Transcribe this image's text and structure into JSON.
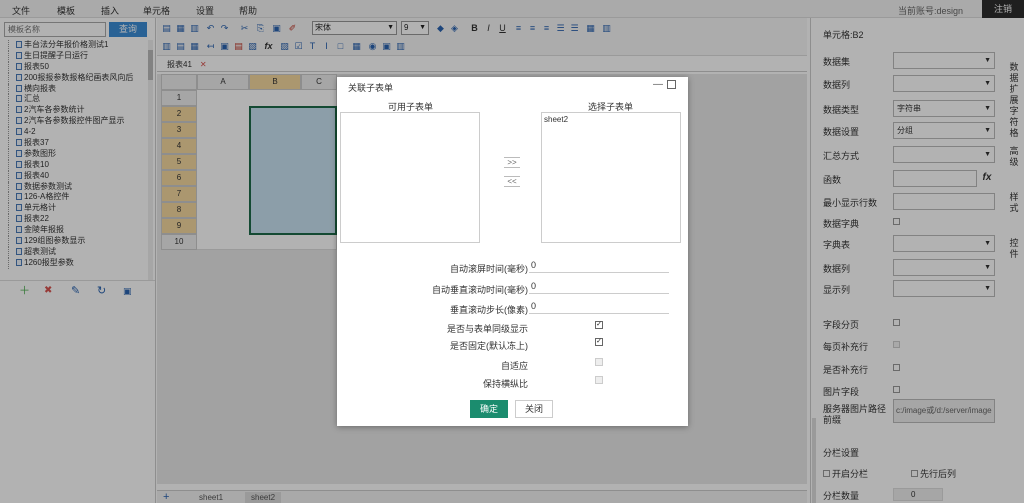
{
  "menubar": {
    "items": [
      "文件",
      "模板",
      "插入",
      "单元格",
      "设置",
      "帮助"
    ],
    "user_label": "当前账号:design",
    "logout_label": "注销"
  },
  "left_panel": {
    "search_placeholder": "模板名称",
    "search_button": "查询",
    "tree_items": [
      "丰台法分年报价格测试1",
      "生日提醒子日运行",
      "报表50",
      "200报报参数报格纪画表风向后",
      "横向报表",
      "汇总",
      "2汽车各参数统计",
      "2汽车各参数报控件图产显示",
      "4-2",
      "报表37",
      "参数图形",
      "报表10",
      "报表40",
      "数据参数测试",
      "126-A格控件",
      "单元格计",
      "报表22",
      "金陵年报报",
      "129组图参数显示",
      "超表测试",
      "1260报型参数"
    ]
  },
  "toolbar": {
    "font_value": "宋体",
    "size_value": "9"
  },
  "sheet_tabs_top": {
    "active": "报表41"
  },
  "grid": {
    "columns": [
      "A",
      "B",
      "C"
    ],
    "rows": [
      "1",
      "2",
      "3",
      "4",
      "5",
      "6",
      "7",
      "8",
      "9",
      "10"
    ]
  },
  "sheet_tabs_bottom": [
    "sheet1",
    "sheet2"
  ],
  "right_panel": {
    "title": "单元格:B2",
    "props": [
      {
        "label": "数据集",
        "value": "",
        "type": "select"
      },
      {
        "label": "数据列",
        "value": "",
        "type": "select"
      },
      {
        "label": "数据类型",
        "value": "字符串",
        "type": "select"
      },
      {
        "label": "数据设置",
        "value": "分组",
        "type": "select"
      },
      {
        "label": "汇总方式",
        "value": "",
        "type": "select"
      },
      {
        "label": "函数",
        "value": "",
        "type": "text"
      },
      {
        "label": "最小显示行数",
        "value": "",
        "type": "text"
      },
      {
        "label": "数据字典",
        "value": "",
        "type": "check"
      },
      {
        "label": "字典表",
        "value": "",
        "type": "select"
      },
      {
        "label": "数据列",
        "value": "",
        "type": "select"
      },
      {
        "label": "显示列",
        "value": "",
        "type": "select"
      }
    ],
    "checks": [
      {
        "label": "字段分页"
      },
      {
        "label": "每页补充行"
      },
      {
        "label": "是否补充行"
      },
      {
        "label": "图片字段"
      }
    ],
    "image_path_label": "服务器图片路径前缀",
    "image_path_value": "c:/image或/d:/server/image",
    "section_label": "分栏设置",
    "col_open_label": "开启分栏",
    "col_first_label": "先行后列",
    "col_count_label": "分栏数量",
    "col_count_value": "0"
  },
  "side_tabs": [
    "数据扩展字符格",
    "高级",
    "样式",
    "控件"
  ],
  "dialog": {
    "title": "关联子表单",
    "available_label": "可用子表单",
    "selected_label": "选择子表单",
    "selected_items": [
      "sheet2"
    ],
    "move_right": ">>",
    "move_left": "<<",
    "fields": [
      {
        "label": "自动滚屏时间(毫秒)",
        "value": "0"
      },
      {
        "label": "自动垂直滚动时间(毫秒)",
        "value": "0"
      },
      {
        "label": "垂直滚动步长(像素)",
        "value": "0"
      }
    ],
    "checks": [
      {
        "label": "是否与表单同级显示",
        "checked": true,
        "disabled": false
      },
      {
        "label": "是否固定(默认冻上)",
        "checked": true,
        "disabled": false
      },
      {
        "label": "自适应",
        "checked": false,
        "disabled": true
      },
      {
        "label": "保持横纵比",
        "checked": false,
        "disabled": true
      }
    ],
    "ok_label": "确定",
    "close_label": "关闭"
  },
  "colors": {
    "accent": "#1b8c6e",
    "search_btn": "#3c8dd6",
    "selection": "#c9e2f2",
    "header_sel": "#f5d9a0"
  }
}
